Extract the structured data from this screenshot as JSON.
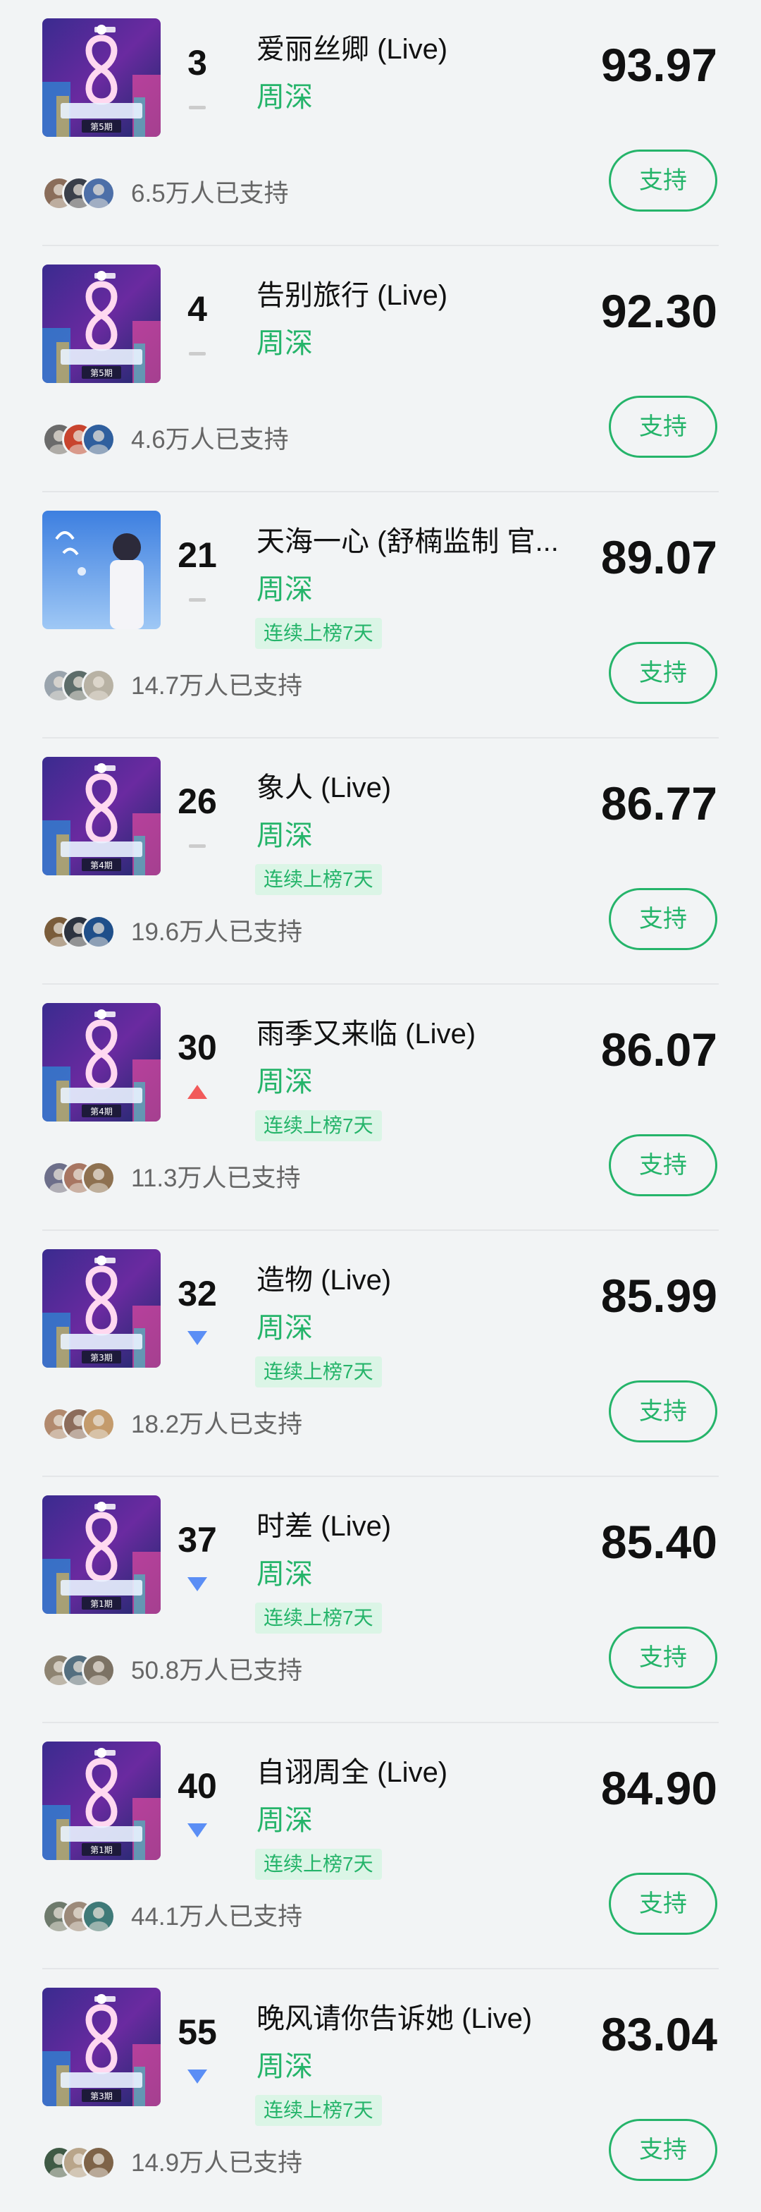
{
  "colors": {
    "accent_green": "#25b46a",
    "badge_bg": "#dbf5e6",
    "trend_up": "#f25a5a",
    "trend_down": "#5b8ef5",
    "trend_flat": "#cccccc"
  },
  "support_label": "支持",
  "items": [
    {
      "rank": "3",
      "trend": "flat",
      "title": "爱丽丝卿 (Live)",
      "artist": "周深",
      "badge": "",
      "score": "93.97",
      "supporters": "6.5万人已支持",
      "cover": "program",
      "episode": "第5期"
    },
    {
      "rank": "4",
      "trend": "flat",
      "title": "告别旅行 (Live)",
      "artist": "周深",
      "badge": "",
      "score": "92.30",
      "supporters": "4.6万人已支持",
      "cover": "program",
      "episode": "第5期"
    },
    {
      "rank": "21",
      "trend": "flat",
      "title": "天海一心 (舒楠监制 官...",
      "artist": "周深",
      "badge": "连续上榜7天",
      "score": "89.07",
      "supporters": "14.7万人已支持",
      "cover": "portrait",
      "episode": ""
    },
    {
      "rank": "26",
      "trend": "flat",
      "title": "象人 (Live)",
      "artist": "周深",
      "badge": "连续上榜7天",
      "score": "86.77",
      "supporters": "19.6万人已支持",
      "cover": "program",
      "episode": "第4期"
    },
    {
      "rank": "30",
      "trend": "up",
      "title": "雨季又来临 (Live)",
      "artist": "周深",
      "badge": "连续上榜7天",
      "score": "86.07",
      "supporters": "11.3万人已支持",
      "cover": "program",
      "episode": "第4期"
    },
    {
      "rank": "32",
      "trend": "down",
      "title": "造物 (Live)",
      "artist": "周深",
      "badge": "连续上榜7天",
      "score": "85.99",
      "supporters": "18.2万人已支持",
      "cover": "program",
      "episode": "第3期"
    },
    {
      "rank": "37",
      "trend": "down",
      "title": "时差 (Live)",
      "artist": "周深",
      "badge": "连续上榜7天",
      "score": "85.40",
      "supporters": "50.8万人已支持",
      "cover": "program",
      "episode": "第1期"
    },
    {
      "rank": "40",
      "trend": "down",
      "title": "自诩周全 (Live)",
      "artist": "周深",
      "badge": "连续上榜7天",
      "score": "84.90",
      "supporters": "44.1万人已支持",
      "cover": "program",
      "episode": "第1期"
    },
    {
      "rank": "55",
      "trend": "down",
      "title": "晚风请你告诉她 (Live)",
      "artist": "周深",
      "badge": "连续上榜7天",
      "score": "83.04",
      "supporters": "14.9万人已支持",
      "cover": "program",
      "episode": "第3期"
    }
  ]
}
